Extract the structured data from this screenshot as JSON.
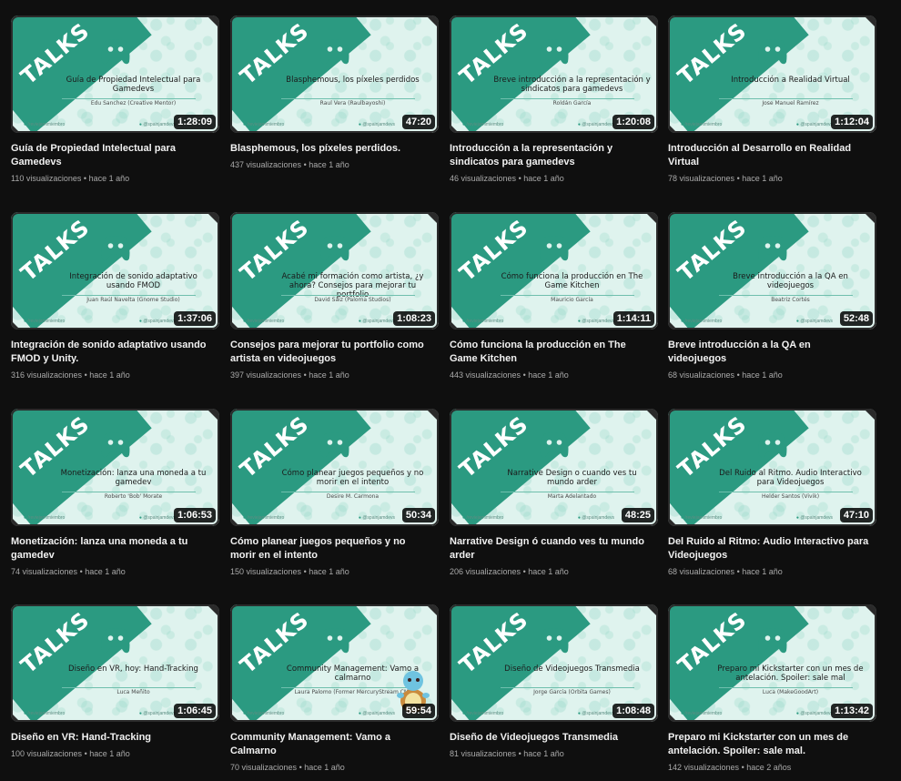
{
  "badge_text": "TALKS",
  "footer_handles": [
    "/reviejamimiembro",
    "@spainjamdevs"
  ],
  "colors": {
    "accent": "#2b9a81",
    "thumb_bg": "#dff3ee",
    "page_bg": "#0f0f0f"
  },
  "videos": [
    {
      "thumb_title": "Guía de Propiedad Intelectual para Gamedevs",
      "thumb_speaker": "Edu Sanchez (Creative Mentor)",
      "duration": "1:28:09",
      "title": "Guía de Propiedad Intelectual para Gamedevs",
      "views": "110 visualizaciones",
      "age": "hace 1 año"
    },
    {
      "thumb_title": "Blasphemous, los píxeles perdidos",
      "thumb_speaker": "Raul Vera (Raulbayoshi)",
      "duration": "47:20",
      "title": "Blasphemous, los píxeles perdidos.",
      "views": "437 visualizaciones",
      "age": "hace 1 año"
    },
    {
      "thumb_title": "Breve introducción a la representación y sindicatos para gamedevs",
      "thumb_speaker": "Roldán García",
      "duration": "1:20:08",
      "title": "Introducción a la representación y sindicatos para gamedevs",
      "views": "46 visualizaciones",
      "age": "hace 1 año"
    },
    {
      "thumb_title": "Introducción a Realidad Virtual",
      "thumb_speaker": "Jose Manuel Ramírez",
      "duration": "1:12:04",
      "title": "Introducción al Desarrollo en Realidad Virtual",
      "views": "78 visualizaciones",
      "age": "hace 1 año"
    },
    {
      "thumb_title": "Integración de sonido adaptativo usando FMOD",
      "thumb_speaker": "Juan Raúl Navelta (Gnome Studio)",
      "duration": "1:37:06",
      "title": "Integración de sonido adaptativo usando FMOD y Unity.",
      "views": "316 visualizaciones",
      "age": "hace 1 año"
    },
    {
      "thumb_title": "Acabé mi formación como artista, ¿y ahora? Consejos para mejorar tu portfolio",
      "thumb_speaker": "David Sáiz (Paloma Studios)",
      "duration": "1:08:23",
      "title": "Consejos para mejorar tu portfolio como artista en videojuegos",
      "views": "397 visualizaciones",
      "age": "hace 1 año"
    },
    {
      "thumb_title": "Cómo funciona la producción en The Game Kitchen",
      "thumb_speaker": "Mauricio García",
      "duration": "1:14:11",
      "title": "Cómo funciona la producción en The Game Kitchen",
      "views": "443 visualizaciones",
      "age": "hace 1 año"
    },
    {
      "thumb_title": "Breve introducción a la QA en videojuegos",
      "thumb_speaker": "Beatriz Cortés",
      "duration": "52:48",
      "title": "Breve introducción a la QA en videojuegos",
      "views": "68 visualizaciones",
      "age": "hace 1 año"
    },
    {
      "thumb_title": "Monetización: lanza una moneda a tu gamedev",
      "thumb_speaker": "Roberto 'Bob' Morate",
      "duration": "1:06:53",
      "title": "Monetización: lanza una moneda a tu gamedev",
      "views": "74 visualizaciones",
      "age": "hace 1 año"
    },
    {
      "thumb_title": "Cómo planear juegos pequeños y no morir en el intento",
      "thumb_speaker": "Desire M. Carmona",
      "duration": "50:34",
      "title": "Cómo planear juegos pequeños y no morir en el intento",
      "views": "150 visualizaciones",
      "age": "hace 1 año"
    },
    {
      "thumb_title": "Narrative Design o cuando ves tu mundo arder",
      "thumb_speaker": "Marta Adelantado",
      "duration": "48:25",
      "title": "Narrative Design ó cuando ves tu mundo arder",
      "views": "206 visualizaciones",
      "age": "hace 1 año"
    },
    {
      "thumb_title": "Del Ruido al Ritmo. Audio Interactivo para Videojuegos",
      "thumb_speaker": "Helder Santos (Vivik)",
      "duration": "47:10",
      "title": "Del Ruido al Ritmo: Audio Interactivo para Videojuegos",
      "views": "68 visualizaciones",
      "age": "hace 1 año"
    },
    {
      "thumb_title": "Diseño en VR, hoy: Hand-Tracking",
      "thumb_speaker": "Luca Meñito",
      "duration": "1:06:45",
      "title": "Diseño en VR: Hand-Tracking",
      "views": "100 visualizaciones",
      "age": "hace 1 año"
    },
    {
      "thumb_title": "Community Management: Vamo a calmarno",
      "thumb_speaker": "Laura Palomo (Former MercuryStream CM)",
      "duration": "59:54",
      "title": "Community Management: Vamo a Calmarno",
      "views": "70 visualizaciones",
      "age": "hace 1 año"
    },
    {
      "thumb_title": "Diseño de Videojuegos Transmedia",
      "thumb_speaker": "Jorge García (Orbita Games)",
      "duration": "1:08:48",
      "title": "Diseño de Videojuegos Transmedia",
      "views": "81 visualizaciones",
      "age": "hace 1 año"
    },
    {
      "thumb_title": "Preparo mi Kickstarter con un mes de antelación. Spoiler: sale mal",
      "thumb_speaker": "Luca (MakeGoodArt)",
      "duration": "1:13:42",
      "title": "Preparo mi Kickstarter con un mes de antelación. Spoiler: sale mal.",
      "views": "142 visualizaciones",
      "age": "hace 2 años"
    }
  ]
}
